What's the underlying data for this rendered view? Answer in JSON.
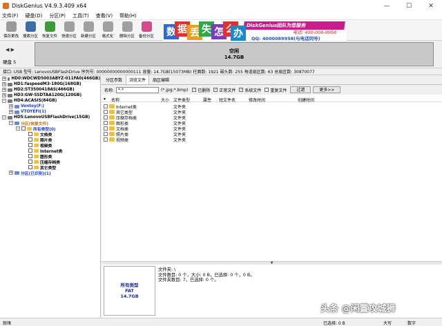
{
  "window": {
    "title": "DiskGenius V4.9.3.409 x64",
    "minimize": "—",
    "maximize": "☐",
    "close": "✕"
  },
  "menu": [
    "文件(F)",
    "硬盘(D)",
    "分区(P)",
    "工具(T)",
    "查看(V)",
    "帮助(H)"
  ],
  "toolbar": [
    {
      "label": "保存更改",
      "color": "#9a9a9a"
    },
    {
      "label": "搜索分区",
      "color": "#3a6ea8"
    },
    {
      "label": "恢复文件",
      "color": "#3f9a3a"
    },
    {
      "label": "快速分区",
      "color": "#a0a0a0"
    },
    {
      "label": "新建分区",
      "color": "#a0a0a0"
    },
    {
      "label": "格式化",
      "color": "#a0a0a0"
    },
    {
      "label": "删除分区",
      "color": "#a0a0a0"
    },
    {
      "label": "备份分区",
      "color": "#d24a8a"
    }
  ],
  "ad": {
    "chars": [
      {
        "c": "数",
        "color": "#2a6ad8"
      },
      {
        "c": "据",
        "color": "#e03030"
      },
      {
        "c": "丢",
        "color": "#e8a020"
      },
      {
        "c": "失",
        "color": "#2ea84a"
      },
      {
        "c": "怎",
        "color": "#7a3ac8"
      },
      {
        "c": "么",
        "color": "#e03030"
      },
      {
        "c": "办",
        "color": "#1a8ad0"
      }
    ],
    "banner": "DiskGenius团队为您服务",
    "phone": "电话: 400-008-9958",
    "qq": "QQ: 4000089958(与电话同号)"
  },
  "disk_map": {
    "nav_left": "◀",
    "nav_right": "▶",
    "disk_label": "硬盘 5",
    "partition_name": "空闲",
    "partition_size": "14.7GB"
  },
  "info_bar": "接口: USB  型号: LenovoUSBFlashDrive  序列号: 00000000000000111  容量: 14.7GB(15073MB)  柱面数: 1921  磁头数: 255  每道扇区数: 63  总扇区数: 30870077",
  "tree": [
    {
      "indent": 0,
      "type": "disk",
      "expander": "+",
      "text": "HD0:WDCWD5003ABYZ-011FA0(466GB)",
      "color": "#000"
    },
    {
      "indent": 0,
      "type": "disk",
      "expander": "+",
      "text": "HD1:faspeedM3-180G(168GB)",
      "color": "#000"
    },
    {
      "indent": 0,
      "type": "disk",
      "expander": "+",
      "text": "HD2:ST3500418AS(466GB)",
      "color": "#000"
    },
    {
      "indent": 0,
      "type": "disk",
      "expander": "+",
      "text": "HD3:GW-SSDTAA120G(120GB)",
      "color": "#000"
    },
    {
      "indent": 0,
      "type": "disk",
      "expander": "-",
      "text": "HD4:ACASIS(84GB)",
      "color": "#000"
    },
    {
      "indent": 1,
      "type": "part",
      "expander": "+",
      "text": "Ventoy(F:)",
      "color": "#1a3ac8"
    },
    {
      "indent": 1,
      "type": "part",
      "expander": "+",
      "text": "VTOYEFI(1)",
      "color": "#1a3ac8"
    },
    {
      "indent": 0,
      "type": "disk",
      "expander": "-",
      "text": "HD5:LenovoUSBFlashDrive(15GB)",
      "color": "#000"
    },
    {
      "indent": 1,
      "type": "part",
      "expander": "-",
      "text": "分区(恢复文件)",
      "color": "#c07010"
    },
    {
      "indent": 2,
      "type": "folder",
      "expander": "-",
      "text": "所有类型(0)",
      "color": "#1a3ac8"
    },
    {
      "indent": 3,
      "type": "folder",
      "expander": "",
      "text": "文档类",
      "color": "#000"
    },
    {
      "indent": 3,
      "type": "folder",
      "expander": "",
      "text": "照片类",
      "color": "#000"
    },
    {
      "indent": 3,
      "type": "folder",
      "expander": "",
      "text": "视频类",
      "color": "#000"
    },
    {
      "indent": 3,
      "type": "folder",
      "expander": "",
      "text": "Internet类",
      "color": "#000"
    },
    {
      "indent": 3,
      "type": "folder",
      "expander": "",
      "text": "图形类",
      "color": "#000"
    },
    {
      "indent": 3,
      "type": "folder",
      "expander": "",
      "text": "压缩存档类",
      "color": "#000"
    },
    {
      "indent": 3,
      "type": "folder",
      "expander": "",
      "text": "其它类型",
      "color": "#000"
    },
    {
      "indent": 1,
      "type": "part",
      "expander": "+",
      "text": "分区(已识别)(1)",
      "color": "#1a3ac8"
    }
  ],
  "tabs": [
    "分区参数",
    "浏览文件",
    "扇区编辑"
  ],
  "filter": {
    "name_label": "名称:",
    "name_value": "*.*",
    "pattern": "(*.jpg;*.bmp)",
    "deleted": "已删除",
    "normal": "正常文件",
    "system": "系统文件",
    "duplicate": "重复文件",
    "filter_btn": "过滤",
    "more_btn": "更多>>"
  },
  "columns": {
    "name": "名称",
    "size": "大小",
    "type": "文件类型",
    "attr": "属性",
    "short": "短文件名",
    "modified": "修改时间",
    "created": "创建时间"
  },
  "files": [
    {
      "name": "Internet类",
      "type": "文件夹"
    },
    {
      "name": "其它类型",
      "type": "文件夹"
    },
    {
      "name": "压缩存档类",
      "type": "文件夹"
    },
    {
      "name": "图形类",
      "type": "文件夹"
    },
    {
      "name": "文档类",
      "type": "文件夹"
    },
    {
      "name": "照片类",
      "type": "文件夹"
    },
    {
      "name": "视频类",
      "type": "文件夹"
    }
  ],
  "bottom": {
    "thumb_line1": "所有类型",
    "thumb_line2": "FAT",
    "thumb_line3": "14.7GB",
    "line1": "文件夹: \\",
    "line2": "文件数目: 0 个，大小: 0 B，已选择: 0 个，0 B。",
    "line3": "文件夹数目: 7，已选择: 0 个。"
  },
  "status": {
    "left": "就绪",
    "selected": "已选择: 0 B",
    "caps": "大写",
    "num": "数字"
  },
  "watermark": "头条 @闲置攻城狮"
}
